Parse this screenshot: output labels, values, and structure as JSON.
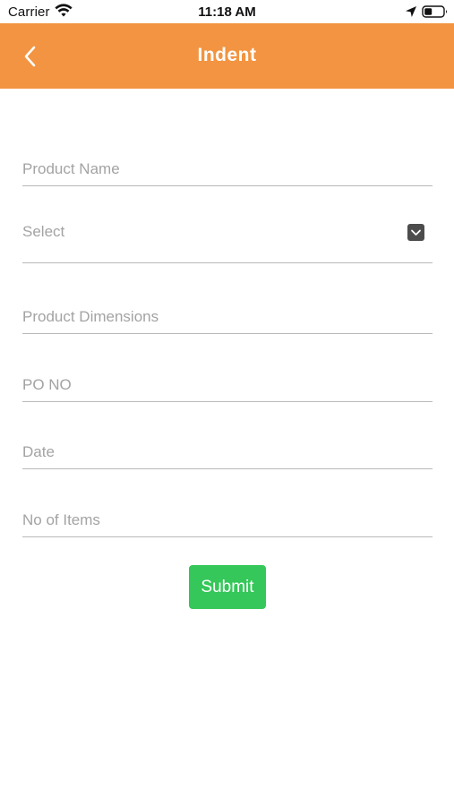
{
  "status_bar": {
    "carrier": "Carrier",
    "time": "11:18 AM",
    "icons": [
      "wifi-icon",
      "location-arrow-icon",
      "battery-icon"
    ]
  },
  "nav": {
    "title": "Indent",
    "back_icon": "chevron-left-icon",
    "background_color": "#f29441"
  },
  "form": {
    "product_name": {
      "placeholder": "Product Name",
      "value": ""
    },
    "select": {
      "label": "Select",
      "icon": "chevron-down-icon"
    },
    "product_dimensions": {
      "placeholder": "Product Dimensions",
      "value": ""
    },
    "po_no": {
      "placeholder": "PO NO",
      "value": ""
    },
    "date": {
      "placeholder": "Date",
      "value": ""
    },
    "no_of_items": {
      "placeholder": "No of Items",
      "value": ""
    }
  },
  "submit": {
    "label": "Submit",
    "color": "#35c759"
  }
}
